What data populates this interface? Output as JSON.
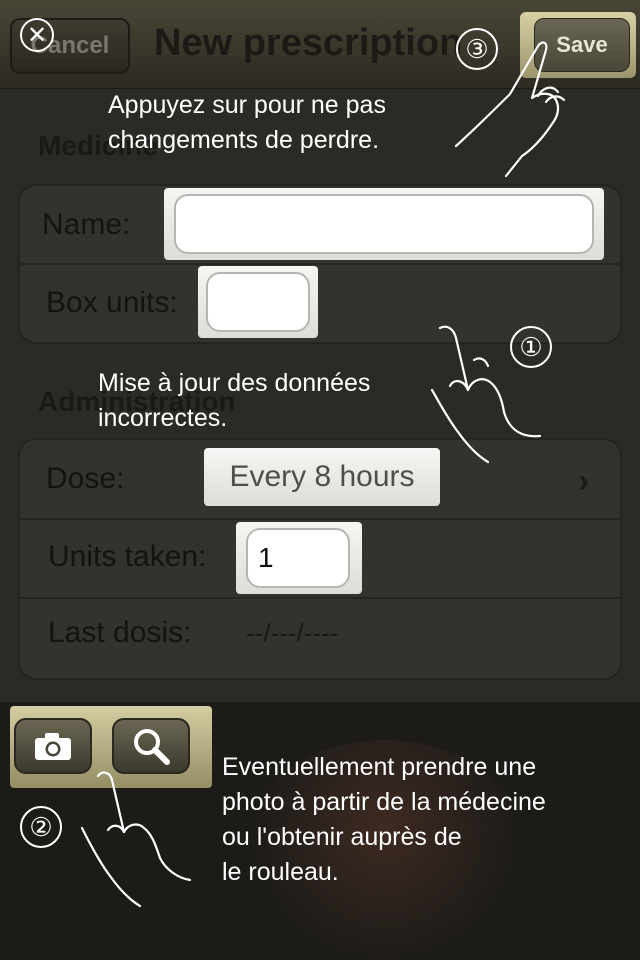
{
  "navbar": {
    "cancel_label": "Cancel",
    "title": "New prescription",
    "save_label": "Save"
  },
  "medicine": {
    "header": "Medicine",
    "name_label": "Name:",
    "name_value": "",
    "box_units_label": "Box units:",
    "box_units_value": ""
  },
  "administration": {
    "header": "Administration",
    "dose_label": "Dose:",
    "dose_value": "Every 8 hours",
    "units_taken_label": "Units taken:",
    "units_taken_value": "1",
    "last_dosis_label": "Last dosis:",
    "last_dosis_value": "--/---/----"
  },
  "toolbar": {
    "camera_icon": "camera-icon",
    "search_icon": "search-icon"
  },
  "overlay": {
    "close_symbol": "✕",
    "tips": [
      {
        "number": "③",
        "lines": [
          "Appuyez sur pour ne pas",
          "changements de perdre."
        ]
      },
      {
        "number": "①",
        "lines": [
          "Mise à jour des données",
          "incorrectes."
        ]
      },
      {
        "number": "②",
        "lines": [
          "Eventuellement prendre une",
          "photo à partir de la médecine",
          "ou l'obtenir auprès de",
          "le rouleau."
        ]
      }
    ]
  },
  "colors": {
    "highlight_gold": "#d5cda2",
    "overlay_text": "#ffffff"
  }
}
